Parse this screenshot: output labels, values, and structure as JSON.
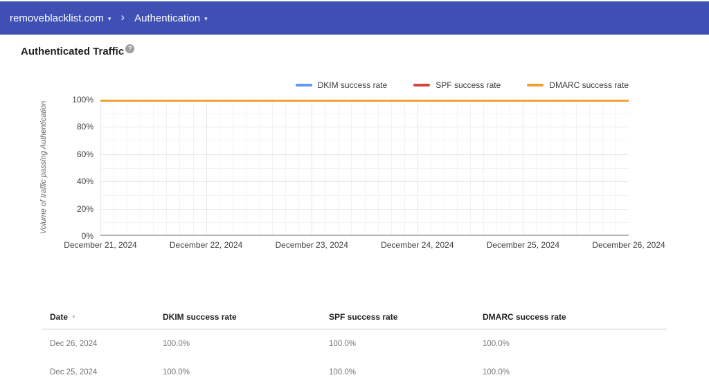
{
  "topbar": {
    "domain": "removeblacklist.com",
    "section": "Authentication",
    "bg_color": "#3e50b4"
  },
  "icons": {
    "dropdown_caret": "▾",
    "breadcrumb_chevron": "›",
    "help": "?",
    "sort_desc": "▼"
  },
  "page": {
    "title": "Authenticated Traffic"
  },
  "chart_data": {
    "type": "line",
    "title": "",
    "xlabel": "",
    "ylabel": "Volume of traffic passing Authentication",
    "x": [
      "December 21, 2024",
      "December 22, 2024",
      "December 23, 2024",
      "December 24, 2024",
      "December 25, 2024",
      "December 26, 2024"
    ],
    "series": [
      {
        "name": "DKIM success rate",
        "color": "#5e97f6",
        "values": [
          100,
          100,
          100,
          100,
          100,
          100
        ]
      },
      {
        "name": "SPF success rate",
        "color": "#d6453a",
        "values": [
          100,
          100,
          100,
          100,
          100,
          100
        ]
      },
      {
        "name": "DMARC success rate",
        "color": "#eea236",
        "values": [
          100,
          100,
          100,
          100,
          100,
          100
        ]
      }
    ],
    "yticks": [
      "0%",
      "20%",
      "40%",
      "60%",
      "80%",
      "100%"
    ],
    "ylim": [
      0,
      100
    ],
    "grid": "on",
    "legend_position": "top-right",
    "grid_colors": {
      "minor": "#f3f3f3",
      "major": "#e6e6e6",
      "axis": "#b5b5b5"
    }
  },
  "table": {
    "headers": [
      "Date",
      "DKIM success rate",
      "SPF success rate",
      "DMARC success rate"
    ],
    "sorted_column": "Date",
    "rows": [
      [
        "Dec 26, 2024",
        "100.0%",
        "100.0%",
        "100.0%"
      ],
      [
        "Dec 25, 2024",
        "100.0%",
        "100.0%",
        "100.0%"
      ]
    ]
  }
}
